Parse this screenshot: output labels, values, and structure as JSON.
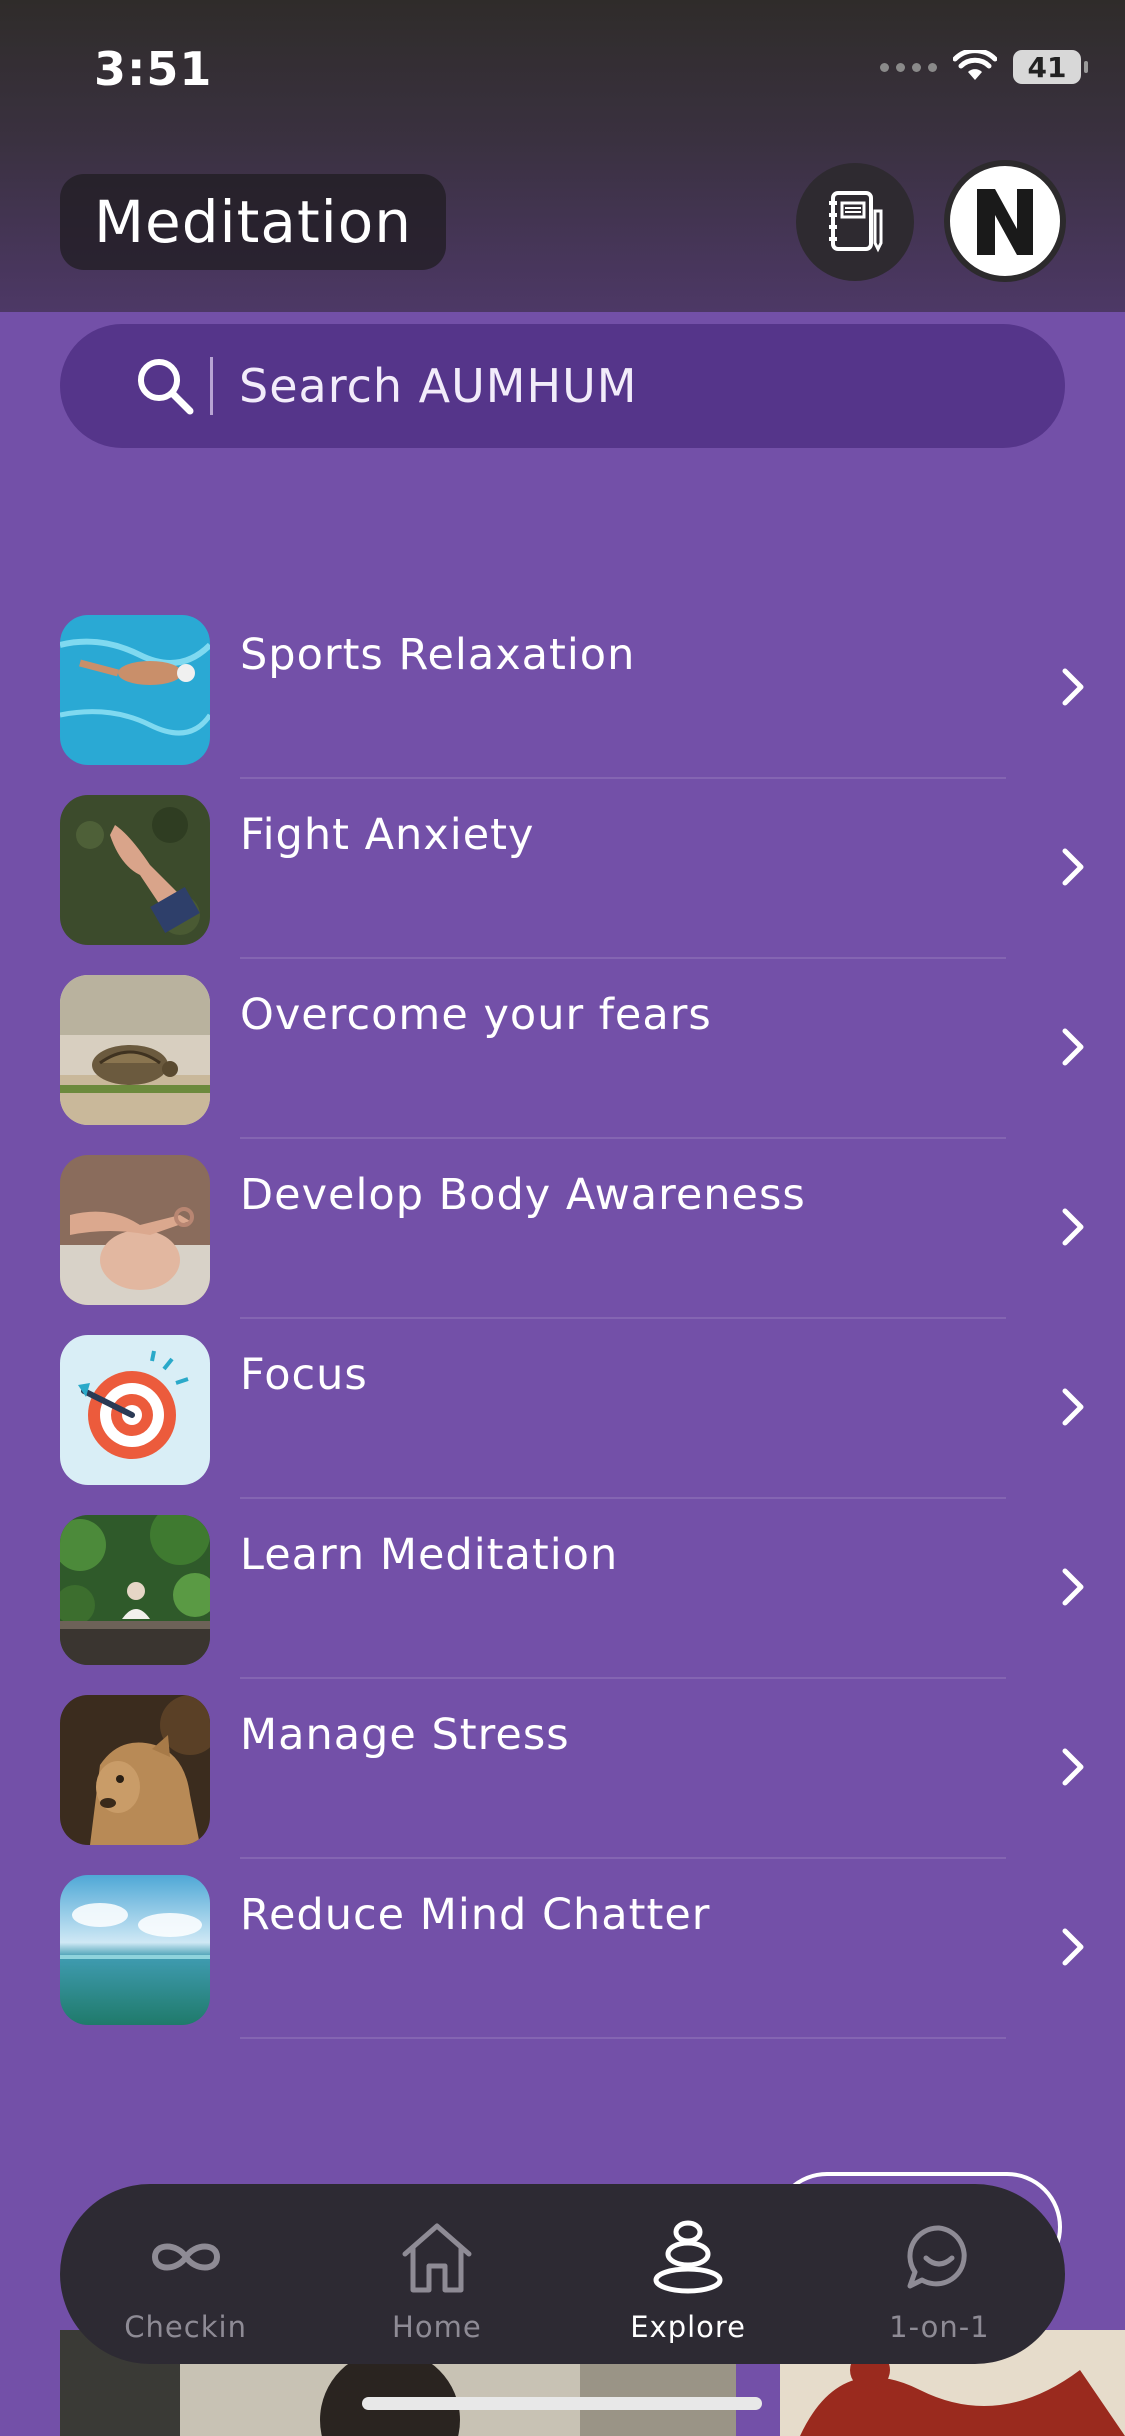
{
  "status_bar": {
    "time": "3:51",
    "battery": "41"
  },
  "header": {
    "title": "Meditation"
  },
  "search": {
    "placeholder": "Search AUMHUM"
  },
  "categories": [
    {
      "label": "Sports Relaxation"
    },
    {
      "label": "Fight Anxiety"
    },
    {
      "label": "Overcome your fears"
    },
    {
      "label": "Develop Body Awareness"
    },
    {
      "label": "Focus"
    },
    {
      "label": "Learn Meditation"
    },
    {
      "label": "Manage Stress"
    },
    {
      "label": "Reduce Mind Chatter"
    }
  ],
  "tabbar": {
    "tabs": [
      {
        "label": "Checkin",
        "icon": "infinity-icon"
      },
      {
        "label": "Home",
        "icon": "home-icon"
      },
      {
        "label": "Explore",
        "icon": "stones-icon",
        "active": true
      },
      {
        "label": "1-on-1",
        "icon": "chat-icon"
      }
    ]
  },
  "colors": {
    "background": "#7350a8",
    "search_bg": "#55358a",
    "tabbar_bg": "#2d2a33"
  }
}
